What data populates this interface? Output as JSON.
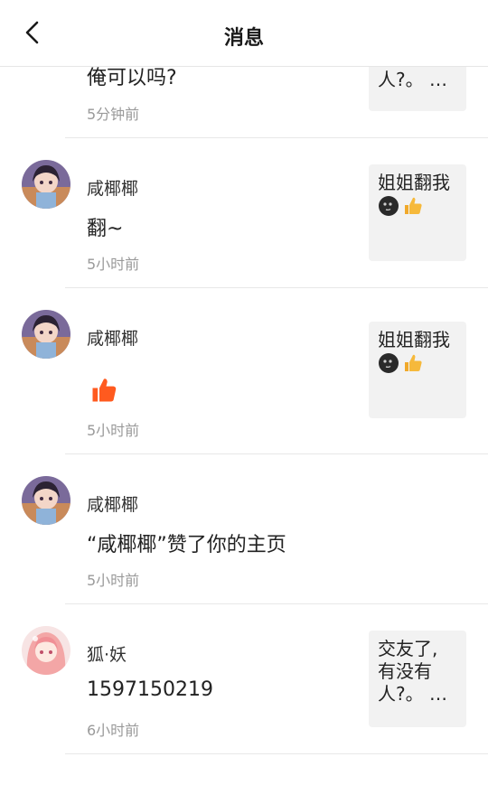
{
  "header": {
    "title": "消息",
    "back_icon": "chevron-left-icon"
  },
  "messages": [
    {
      "content": "俺可以吗?",
      "time": "5分钟前",
      "thumb_text": "人?。 …"
    },
    {
      "name": "咸椰椰",
      "content": "翻~",
      "time": "5小时前",
      "thumb_text": "姐姐翻我",
      "thumb_emoji": [
        "moon-face-icon",
        "thumbs-up-icon"
      ]
    },
    {
      "name": "咸椰椰",
      "content_icon": "thumbs-up-icon",
      "time": "5小时前",
      "thumb_text": "姐姐翻我",
      "thumb_emoji": [
        "moon-face-icon",
        "thumbs-up-icon"
      ]
    },
    {
      "name": "咸椰椰",
      "content": "“咸椰椰”赞了你的主页",
      "time": "5小时前"
    },
    {
      "name": "狐·妖",
      "content": "1597150219",
      "time": "6小时前",
      "thumb_line1": "交友了,",
      "thumb_line2": "有没有",
      "thumb_line3": "人?。 …"
    }
  ],
  "colors": {
    "accent_orange": "#ff5a1f",
    "thumb_bg": "#f2f2f2",
    "divider": "#e8e8e8",
    "time_gray": "#9a9a9a"
  }
}
